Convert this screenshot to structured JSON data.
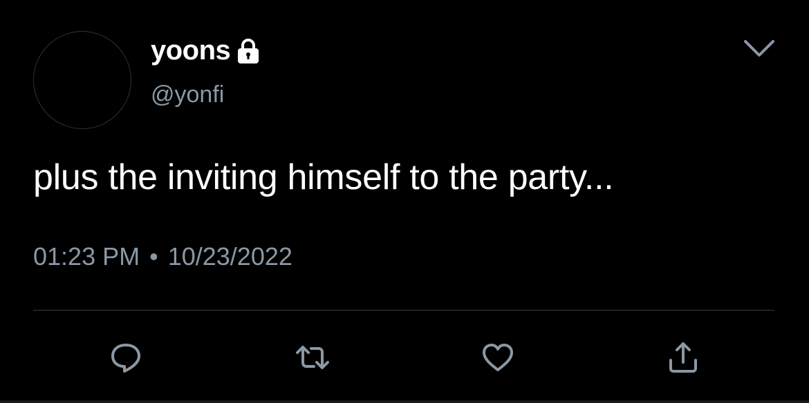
{
  "user": {
    "display_name": "yoons",
    "handle": "@yonfi",
    "protected_icon": "lock-icon"
  },
  "tweet": {
    "text": "plus the inviting himself to the party...",
    "time": "01:23 PM",
    "separator": "•",
    "date": "10/23/2022"
  },
  "actions": [
    {
      "name": "reply",
      "icon": "reply-icon"
    },
    {
      "name": "retweet",
      "icon": "retweet-icon"
    },
    {
      "name": "like",
      "icon": "heart-icon"
    },
    {
      "name": "share",
      "icon": "share-icon"
    }
  ],
  "colors": {
    "background": "#000000",
    "text_primary": "#ffffff",
    "text_secondary": "#8b98a5",
    "icon": "#8b98a5"
  }
}
